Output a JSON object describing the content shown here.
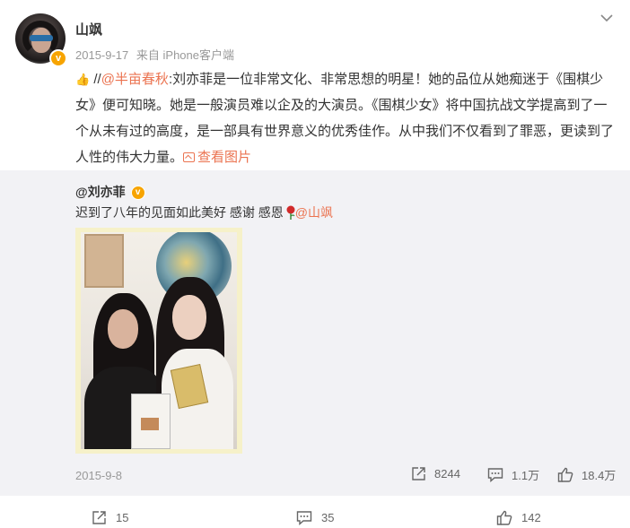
{
  "post": {
    "username": "山飒",
    "date": "2015-9-17",
    "source": "来自 iPhone客户端",
    "prefix": "//",
    "mention": "@半亩春秋",
    "text": ":刘亦菲是一位非常文化、非常思想的明星！她的品位从她痴迷于《围棋少女》便可知晓。她是一般演员难以企及的大演员。《围棋少女》将中国抗战文学提高到了一个从未有过的高度，是一部具有世界意义的优秀佳作。从中我们不仅看到了罪恶，更读到了人性的伟大力量。",
    "view_pics_label": "查看图片"
  },
  "repost": {
    "username": "@刘亦菲",
    "text": "迟到了八年的见面如此美好 感谢 感恩",
    "mention": "@山飒",
    "date": "2015-9-8",
    "share_count": "8244",
    "comment_count": "1.1万",
    "like_count": "18.4万"
  },
  "bottom_bar": {
    "share_count": "15",
    "comment_count": "35",
    "like_count": "142"
  },
  "icons": {
    "more": "chevron-down-icon",
    "share": "share-icon",
    "comment": "comment-icon",
    "like": "thumbs-up-icon",
    "verified": "verified-badge-icon",
    "emoji": "thumbs-up-emoji-icon",
    "rose": "rose-emoji-icon",
    "picture": "picture-icon"
  },
  "colors": {
    "link": "#eb7350",
    "verified": "#f7a400",
    "repost_bg": "#f2f2f5"
  }
}
